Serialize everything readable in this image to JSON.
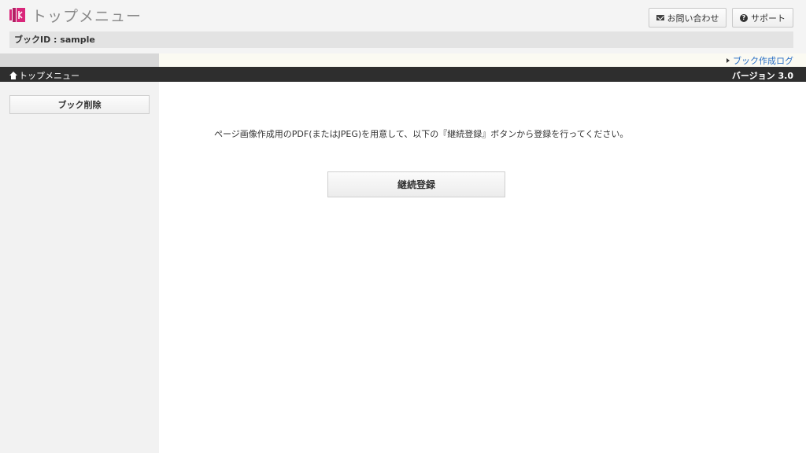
{
  "header": {
    "title": "トップメニュー",
    "contact_label": "お問い合わせ",
    "support_label": "サポート",
    "book_id": "ブックID : sample"
  },
  "logbar": {
    "link_label": "ブック作成ログ"
  },
  "navbar": {
    "breadcrumb": "トップメニュー",
    "version": "バージョン 3.0"
  },
  "sidebar": {
    "delete_book_label": "ブック削除"
  },
  "main": {
    "instruction": "ページ画像作成用のPDF(またはJPEG)を用意して、以下の『継続登録』ボタンから登録を行ってください。",
    "register_label": "継続登録"
  },
  "icons": {
    "logo": "app-logo",
    "contact": "mail-icon",
    "support": "help-icon",
    "log_link": "triangle-right-icon",
    "breadcrumb": "home-icon"
  },
  "colors": {
    "logo_pink": "#d9267a",
    "link": "#2a6fc4",
    "navbar": "#2e2e2e"
  }
}
